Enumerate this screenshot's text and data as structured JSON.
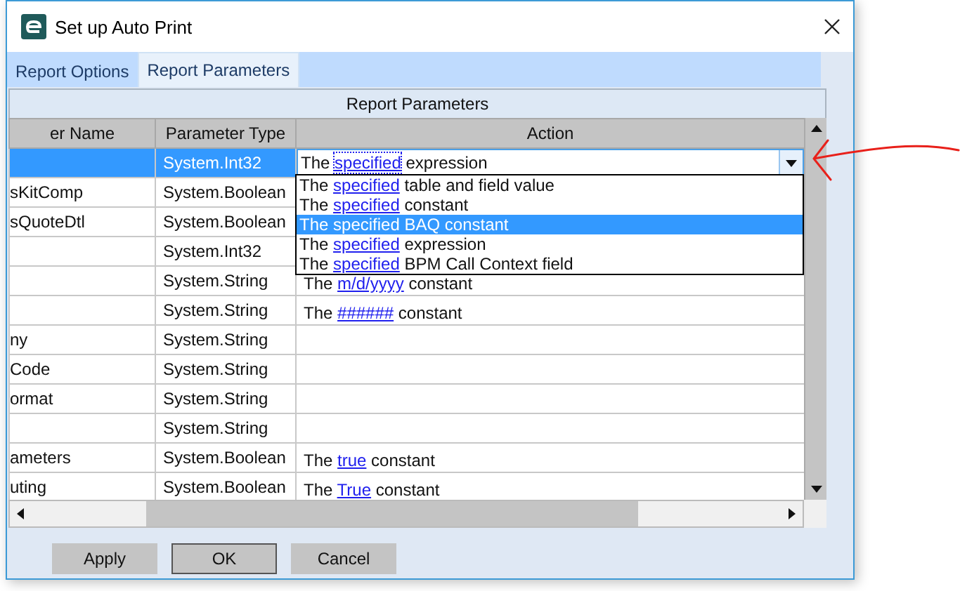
{
  "window": {
    "title": "Set up Auto Print"
  },
  "tabs": [
    {
      "label": "Report Options",
      "selected": false
    },
    {
      "label": "Report Parameters",
      "selected": true
    }
  ],
  "grid": {
    "group_header": "Report Parameters",
    "columns": [
      "er Name",
      "Parameter Type",
      "Action"
    ],
    "rows": [
      {
        "type": "System.Int32",
        "selected": true,
        "editor": {
          "prefix": "The",
          "link": "specified",
          "suffix": "expression"
        }
      },
      {
        "name": "sKitComp",
        "type": "System.Boolean",
        "selected": false
      },
      {
        "name": "sQuoteDtl",
        "type": "System.Boolean",
        "selected": false
      },
      {
        "type": "System.Int32",
        "selected": false
      },
      {
        "type": "System.String",
        "selected": false,
        "action": {
          "prefix": "The",
          "link": "m/d/yyyy",
          "suffix": "constant"
        }
      },
      {
        "type": "System.String",
        "selected": false,
        "action": {
          "prefix": "The",
          "link": "######",
          "suffix": "constant"
        }
      },
      {
        "name": "ny",
        "type": "System.String",
        "selected": false
      },
      {
        "name": "Code",
        "type": "System.String",
        "selected": false
      },
      {
        "name": "ormat",
        "type": "System.String",
        "selected": false
      },
      {
        "type": "System.String",
        "selected": false
      },
      {
        "name": "ameters",
        "type": "System.Boolean",
        "selected": false,
        "action": {
          "prefix": "The",
          "link": "true",
          "suffix": "constant"
        }
      },
      {
        "name": "uting",
        "type": "System.Boolean",
        "selected": false,
        "action": {
          "prefix": "The",
          "link": "True",
          "suffix": "constant"
        }
      }
    ]
  },
  "dropdown": {
    "items": [
      {
        "prefix": "The",
        "link": "specified",
        "suffix": "table and field value",
        "selected": false
      },
      {
        "prefix": "The",
        "link": "specified",
        "suffix": "constant",
        "selected": false
      },
      {
        "prefix": "The",
        "link": "specified",
        "suffix": "BAQ constant",
        "selected": true
      },
      {
        "prefix": "The",
        "link": "specified",
        "suffix": "expression",
        "selected": false
      },
      {
        "prefix": "The",
        "link": "specified",
        "suffix": "BPM Call Context field",
        "selected": false
      }
    ]
  },
  "buttons": [
    {
      "label": "Apply",
      "default": false
    },
    {
      "label": "OK",
      "default": true
    },
    {
      "label": "Cancel",
      "default": false
    }
  ]
}
